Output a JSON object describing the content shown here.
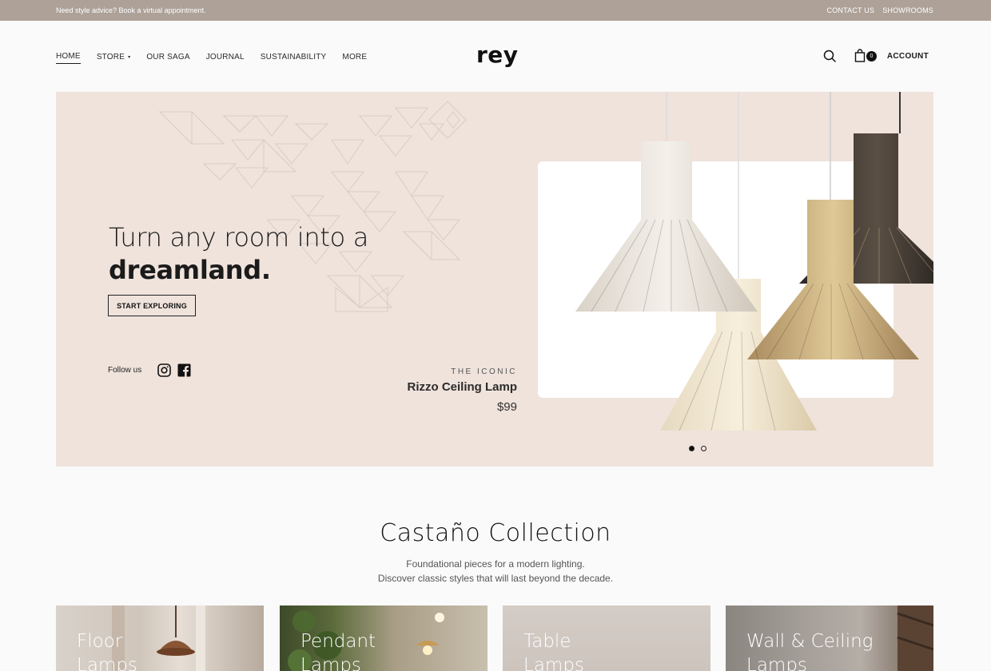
{
  "topbar": {
    "promo": "Need style advice? Book a virtual appointment.",
    "links": [
      "CONTACT US",
      "SHOWROOMS"
    ]
  },
  "header": {
    "logo": "rey",
    "nav": [
      {
        "label": "HOME",
        "active": true
      },
      {
        "label": "STORE",
        "dropdown": true
      },
      {
        "label": "OUR SAGA"
      },
      {
        "label": "JOURNAL"
      },
      {
        "label": "SUSTAINABILITY"
      },
      {
        "label": "MORE"
      }
    ],
    "cart_count": "0",
    "account_label": "ACCOUNT",
    "icons": [
      "search-icon",
      "cart-icon"
    ]
  },
  "hero": {
    "headline_line1": "Turn any room into a",
    "headline_line2": "dreamland.",
    "cta_label": "START EXPLORING",
    "follow_label": "Follow us",
    "social_icons": [
      "instagram-icon",
      "facebook-icon"
    ],
    "product_eyebrow": "THE ICONIC",
    "product_name": "Rizzo Ceiling Lamp",
    "product_price": "$99",
    "slides": 2,
    "active_slide": 1,
    "background_color": "#efe3dc"
  },
  "collection": {
    "title": "Castaño Collection",
    "subtitle_line1": "Foundational pieces for a modern lighting.",
    "subtitle_line2": "Discover classic styles that will last beyond the decade."
  },
  "categories": [
    {
      "line1": "Floor",
      "line2": "Lamps"
    },
    {
      "line1": "Pendant",
      "line2": "Lamps"
    },
    {
      "line1": "Table",
      "line2": "Lamps"
    },
    {
      "line1": "Wall & Ceiling",
      "line2": "Lamps"
    }
  ]
}
